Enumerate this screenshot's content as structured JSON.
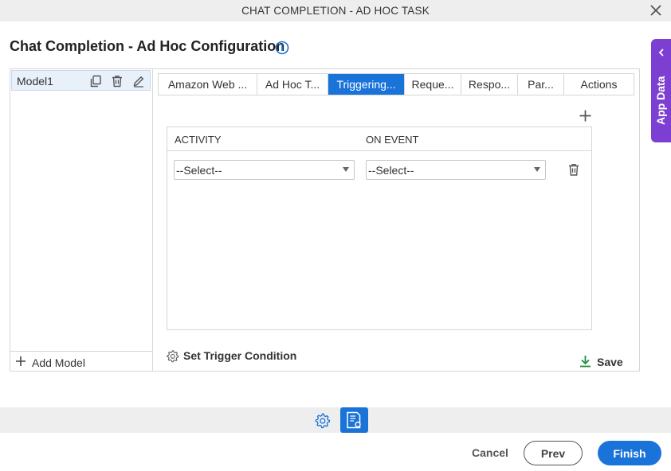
{
  "window": {
    "title": "CHAT COMPLETION - AD HOC TASK",
    "close_icon": "close-icon"
  },
  "page": {
    "heading": "Chat Completion - Ad Hoc Configuration",
    "info_icon": "info-icon"
  },
  "app_data_tab": {
    "label": "App Data",
    "icon": "chevron-left-icon",
    "color": "#7d3fd2"
  },
  "models": {
    "items": [
      {
        "label": "Model1",
        "actions": [
          "copy-icon",
          "trash-icon",
          "edit-icon"
        ]
      }
    ],
    "add_label": "Add Model"
  },
  "tabs": [
    {
      "label": "Amazon Web ...",
      "active": false
    },
    {
      "label": "Ad Hoc T...",
      "active": false
    },
    {
      "label": "Triggering...",
      "active": true
    },
    {
      "label": "Reque...",
      "active": false
    },
    {
      "label": "Respo...",
      "active": false
    },
    {
      "label": "Par...",
      "active": false
    },
    {
      "label": "Actions",
      "active": false
    }
  ],
  "trigger_table": {
    "columns": [
      "ACTIVITY",
      "ON EVENT"
    ],
    "rows": [
      {
        "activity": "--Select--",
        "on_event": "--Select--"
      }
    ]
  },
  "set_trigger_condition_label": "Set Trigger Condition",
  "save_label": "Save",
  "footer": {
    "cancel_label": "Cancel",
    "prev_label": "Prev",
    "finish_label": "Finish"
  },
  "colors": {
    "accent": "#1a73d9",
    "save_icon": "#1e8e3e",
    "app_data": "#7d3fd2"
  }
}
